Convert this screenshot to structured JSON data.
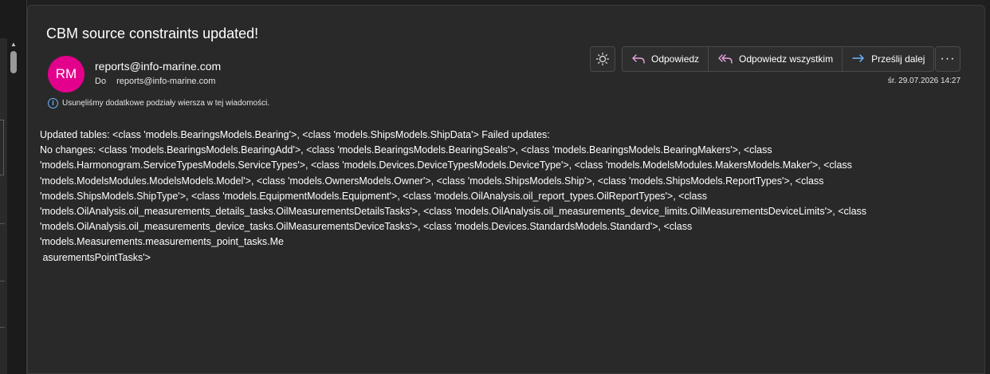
{
  "message": {
    "subject": "CBM source constraints updated!",
    "avatar_initials": "RM",
    "avatar_color": "#e3008c",
    "sender": "reports@info-marine.com",
    "to_label": "Do",
    "to_address": "reports@info-marine.com",
    "info_text": "Usunęliśmy dodatkowe podziały wiersza w tej wiadomości.",
    "date": "śr. 29.07.2026 14:27"
  },
  "toolbar": {
    "theme_icon": "sun-icon",
    "reply_label": "Odpowiedz",
    "reply_all_label": "Odpowiedz wszystkim",
    "forward_label": "Prześlij dalej",
    "more_label": "···"
  },
  "colors": {
    "reply_icon": "#e8a0e0",
    "forward_icon": "#6cb6ff",
    "info_icon": "#6cb6ff"
  },
  "body": {
    "lines": [
      "Updated tables: <class 'models.BearingsModels.Bearing'>, <class 'models.ShipsModels.ShipData'> Failed updates:",
      "No changes: <class 'models.BearingsModels.BearingAdd'>, <class 'models.BearingsModels.BearingSeals'>, <class 'models.BearingsModels.BearingMakers'>, <class",
      "'models.Harmonogram.ServiceTypesModels.ServiceTypes'>, <class 'models.Devices.DeviceTypesModels.DeviceType'>, <class 'models.ModelsModules.MakersModels.Maker'>, <class",
      "'models.ModelsModules.ModelsModels.Model'>, <class 'models.OwnersModels.Owner'>, <class 'models.ShipsModels.Ship'>, <class 'models.ShipsModels.ReportTypes'>, <class",
      "'models.ShipsModels.ShipType'>, <class 'models.EquipmentModels.Equipment'>, <class 'models.OilAnalysis.oil_report_types.OilReportTypes'>, <class",
      "'models.OilAnalysis.oil_measurements_details_tasks.OilMeasurementsDetailsTasks'>, <class 'models.OilAnalysis.oil_measurements_device_limits.OilMeasurementsDeviceLimits'>, <class",
      "'models.OilAnalysis.oil_measurements_device_tasks.OilMeasurementsDeviceTasks'>, <class 'models.Devices.StandardsModels.Standard'>, <class",
      "'models.Measurements.measurements_point_tasks.Me",
      " asurementsPointTasks'>"
    ]
  }
}
